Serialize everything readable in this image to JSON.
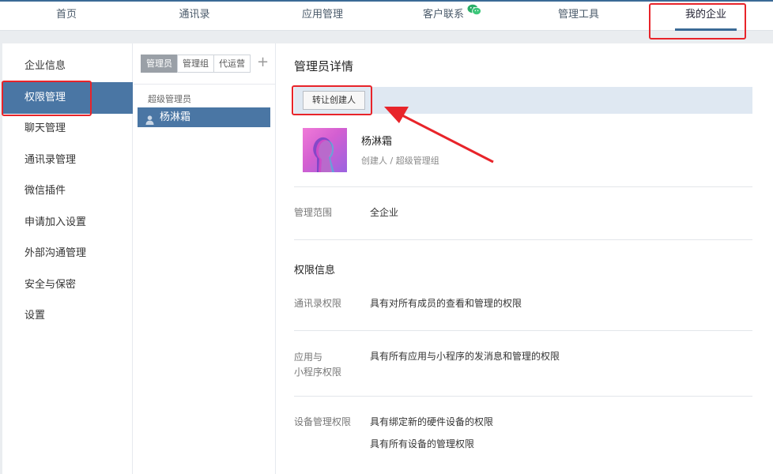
{
  "topnav": {
    "items": [
      {
        "label": "首页"
      },
      {
        "label": "通讯录"
      },
      {
        "label": "应用管理"
      },
      {
        "label": "客户联系",
        "icon": "wechat-icon"
      },
      {
        "label": "管理工具"
      },
      {
        "label": "我的企业",
        "active": true
      }
    ]
  },
  "sidebar": {
    "items": [
      {
        "label": "企业信息"
      },
      {
        "label": "权限管理",
        "active": true
      },
      {
        "label": "聊天管理"
      },
      {
        "label": "通讯录管理"
      },
      {
        "label": "微信插件"
      },
      {
        "label": "申请加入设置"
      },
      {
        "label": "外部沟通管理"
      },
      {
        "label": "安全与保密"
      },
      {
        "label": "设置"
      }
    ]
  },
  "admin_list": {
    "tabs": [
      {
        "label": "管理员",
        "active": true
      },
      {
        "label": "管理组"
      },
      {
        "label": "代运营"
      }
    ],
    "add_label": "+",
    "group_title": "超级管理员",
    "selected_admin": "杨淋霜"
  },
  "detail": {
    "title": "管理员详情",
    "transfer_button": "转让创建人",
    "name": "杨淋霜",
    "role": "创建人 / 超级管理组",
    "scope_label": "管理范围",
    "scope_value": "全企业",
    "permissions_title": "权限信息",
    "contacts_label": "通讯录权限",
    "contacts_value": "具有对所有成员的查看和管理的权限",
    "apps_label_line1": "应用与",
    "apps_label_line2": "小程序权限",
    "apps_value": "具有所有应用与小程序的发消息和管理的权限",
    "devices_label": "设备管理权限",
    "devices_value_1": "具有绑定新的硬件设备的权限",
    "devices_value_2": "具有所有设备的管理权限"
  },
  "colors": {
    "accent": "#4a76a4",
    "annotation": "#e8242a",
    "toolbar_bg": "#dfe8f2"
  }
}
